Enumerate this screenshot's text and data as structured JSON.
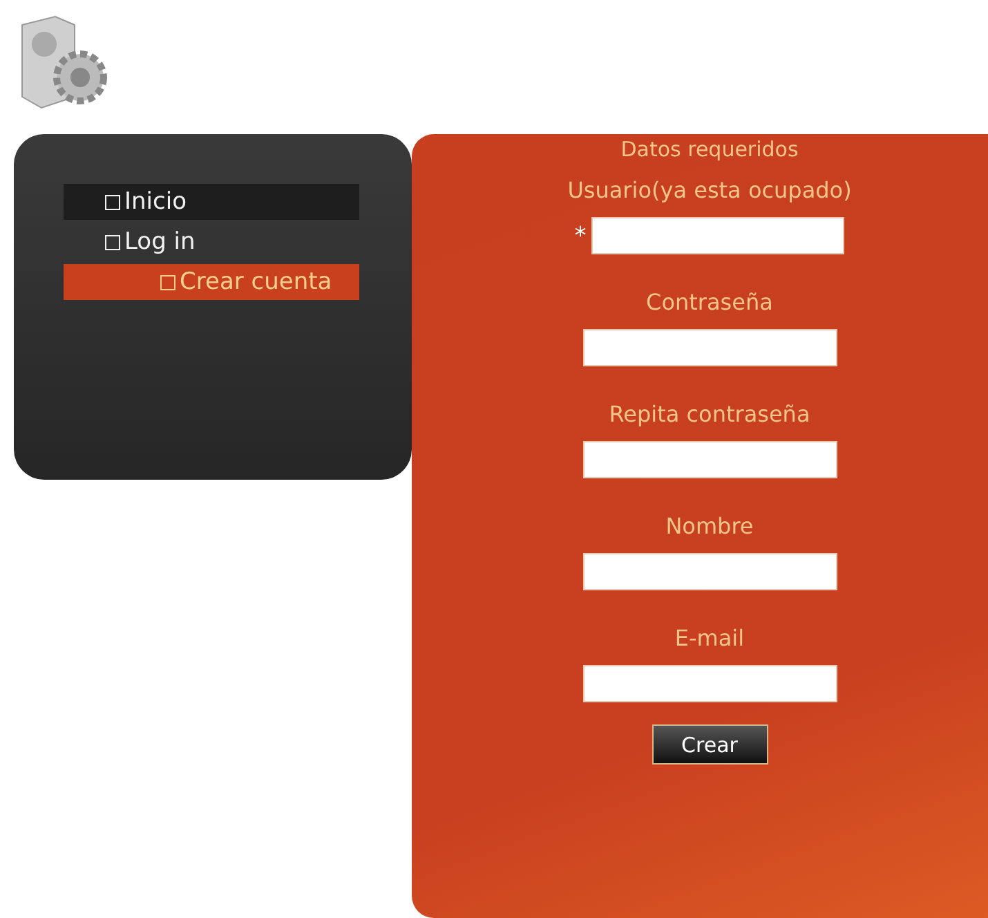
{
  "menu": [
    {
      "label": "Inicio",
      "selected": false,
      "highlighted": true
    },
    {
      "label": "Log in",
      "selected": false,
      "highlighted": false,
      "children": [
        {
          "label": "Crear cuenta",
          "selected": true
        }
      ]
    }
  ],
  "form": {
    "title": "Datos requeridos",
    "fields": [
      {
        "label": "Usuario(ya esta ocupado)",
        "marker": "*"
      },
      {
        "label": "Contraseña"
      },
      {
        "label": "Repita contraseña"
      },
      {
        "label": "Nombre"
      },
      {
        "label": "E-mail"
      }
    ],
    "submit": "Crear"
  }
}
